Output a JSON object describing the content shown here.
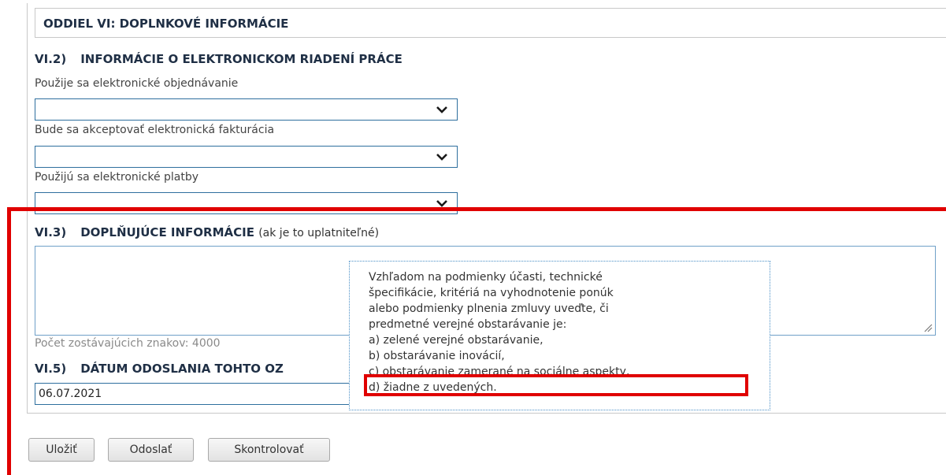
{
  "section": {
    "header": "ODDIEL VI: DOPLNKOVÉ INFORMÁCIE"
  },
  "vi2": {
    "number": "VI.2)",
    "title": "INFORMÁCIE O ELEKTRONICKOM RIADENÍ PRÁCE",
    "fields": [
      {
        "label": "Použije sa elektronické objednávanie",
        "value": ""
      },
      {
        "label": "Bude sa akceptovať elektronická fakturácia",
        "value": ""
      },
      {
        "label": "Použijú sa elektronické platby",
        "value": ""
      }
    ]
  },
  "vi3": {
    "number": "VI.3)",
    "title": "DOPLŇUJÚCE INFORMÁCIE",
    "note": "(ak je to uplatniteľné)",
    "textarea_value": "",
    "counter": "Počet zostávajúcich znakov: 4000"
  },
  "vi5": {
    "number": "VI.5)",
    "title": "DÁTUM ODOSLANIA TOHTO OZ",
    "date_value": "06.07.2021"
  },
  "tooltip": {
    "lines": [
      "Vzhľadom na podmienky účasti, technické",
      "špecifikácie, kritériá na vyhodnotenie ponúk",
      "alebo podmienky plnenia zmluvy uveďte, či",
      "predmetné verejné obstarávanie je:",
      "a) zelené verejné obstarávanie,",
      "b) obstarávanie inovácií,",
      "c) obstarávanie zamerané na sociálne aspekty,",
      "d) žiadne z uvedených."
    ]
  },
  "buttons": {
    "save": "Uložiť",
    "send": "Odoslať",
    "check": "Skontrolovať"
  },
  "colors": {
    "heading": "#1f2f45",
    "input_border": "#2e6f9e",
    "highlight": "#e00000"
  },
  "icons": [
    "chevron-down-icon",
    "resize-grip-icon"
  ]
}
